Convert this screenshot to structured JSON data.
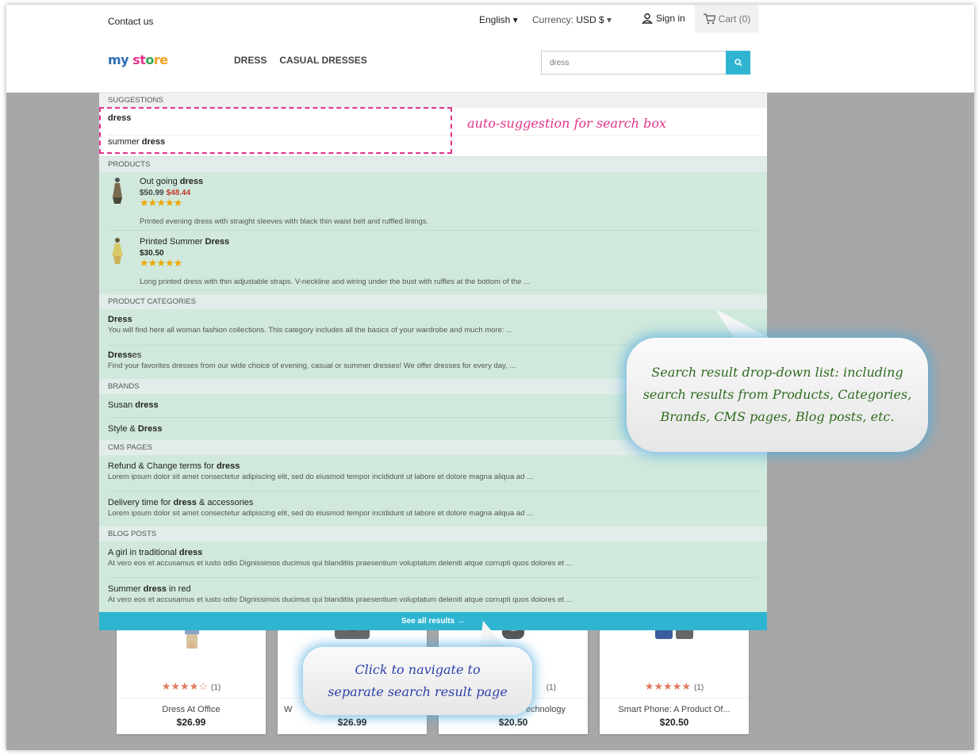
{
  "header": {
    "contact": "Contact us",
    "language": "English",
    "currency_label": "Currency:",
    "currency_value": "USD $",
    "signin": "Sign in",
    "cart": "Cart (0)",
    "logo": {
      "p1": "my ",
      "p2": "st",
      "p3": "o",
      "p4": "re"
    },
    "nav": [
      "DRESS",
      "CASUAL DRESSES"
    ],
    "search_value": "dress"
  },
  "dropdown": {
    "suggestions_head": "SUGGESTIONS",
    "suggestions": [
      {
        "pre": "",
        "bold": "dress",
        "post": ""
      },
      {
        "pre": "summer ",
        "bold": "dress",
        "post": ""
      }
    ],
    "products_head": "PRODUCTS",
    "products": [
      {
        "pre": "Out going ",
        "bold": "dress",
        "post": "",
        "price_old": "$50.99",
        "price_new": "$48.44",
        "rating": 5,
        "desc": "Printed evening dress with straight sleeves with black thin waist belt and ruffled linings."
      },
      {
        "pre": "Printed Summer ",
        "bold": "Dress",
        "post": "",
        "price_old": "$30.50",
        "price_new": "",
        "rating": 5,
        "desc": "Long printed dress with thin adjustable straps. V-neckline and wiring under the bust with ruffles at the bottom of the ..."
      }
    ],
    "categories_head": "PRODUCT CATEGORIES",
    "categories": [
      {
        "pre": "",
        "bold": "Dress",
        "post": "",
        "desc": "You will find here all woman fashion collections. This category includes all the basics of your wardrobe and much more: ..."
      },
      {
        "pre": "",
        "bold": "Dress",
        "post": "es",
        "desc": "Find your favorites dresses from our wide choice of evening, casual or summer dresses! We offer dresses for every day, ..."
      }
    ],
    "brands_head": "BRANDS",
    "brands": [
      {
        "pre": "Susan ",
        "bold": "dress",
        "post": ""
      },
      {
        "pre": "Style & ",
        "bold": "Dress",
        "post": ""
      }
    ],
    "cms_head": "CMS PAGES",
    "cms": [
      {
        "pre": "Refund & Change terms for ",
        "bold": "dress",
        "post": "",
        "desc": "Lorem ipsum dolor sit amet consectetur adipiscing elit, sed do eiusmod tempor incididunt ut labore et dolore magna aliqua ad ..."
      },
      {
        "pre": "Delivery time for ",
        "bold": "dress",
        "post": " & accessories",
        "desc": "Lorem ipsum dolor sit amet consectetur adipiscing elit, sed do eiusmod tempor incididunt ut labore et dolore magna aliqua ad ..."
      }
    ],
    "blog_head": "BLOG POSTS",
    "blog": [
      {
        "pre": "A girl in traditional ",
        "bold": "dress",
        "post": "",
        "desc": "At vero eos et accusamus et iusto odio Dignissimos ducimus qui blanditiis praesentium voluptatum deleniti atque corrupti quos dolores et ..."
      },
      {
        "pre": "Summer ",
        "bold": "dress",
        "post": " in red",
        "desc": "At vero eos et accusamus et iusto odio Dignissimos ducimus qui blanditiis praesentium voluptatum deleniti atque corrupti quos dolores et ..."
      }
    ],
    "see_all": "See all results →"
  },
  "background_products": [
    {
      "name": "Dress At Office",
      "price": "$26.99",
      "rating": 4,
      "reviews": "(1)"
    },
    {
      "name": "W",
      "price": "$26.99"
    },
    {
      "name": "echnology",
      "price": "$20.50",
      "reviews": "(1)"
    },
    {
      "name": "Smart Phone: A Product Of...",
      "price": "$20.50",
      "rating": 5,
      "reviews": "(1)"
    }
  ],
  "annotations": {
    "suggest": "auto-suggestion for search box",
    "dropdown_note": [
      "Search result drop-down list: including",
      "search results from Products, Categories,",
      "Brands, CMS pages, Blog posts, etc."
    ],
    "navigate_note": [
      "Click to navigate to",
      "separate search result page"
    ]
  },
  "colors": {
    "accent": "#2fb5d2",
    "annotation_pink": "#e23387",
    "dropdown_bg": "#d0e9dc"
  }
}
